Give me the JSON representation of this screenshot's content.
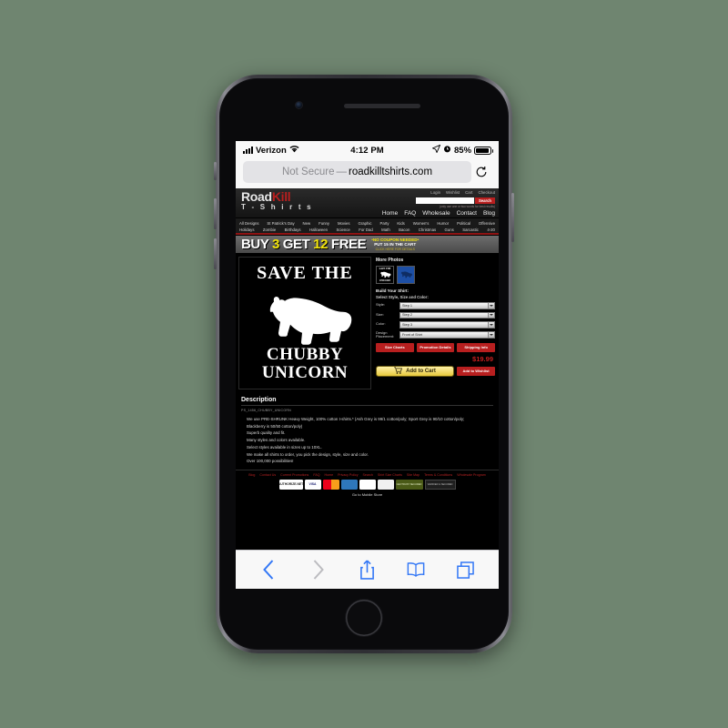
{
  "device": {
    "statusbar": {
      "carrier": "Verizon",
      "time": "4:12 PM",
      "battery_percent": "85%",
      "signal_icon": "signal-bars-icon",
      "wifi_icon": "wifi-icon",
      "location_icon": "location-arrow-icon",
      "alarm_icon": "alarm-clock-icon",
      "battery_icon": "battery-icon"
    },
    "browser": {
      "security_label": "Not Secure",
      "separator": "—",
      "host": "roadkilltshirts.com",
      "reload_icon": "reload-icon",
      "toolbar": {
        "back_icon": "chevron-left-icon",
        "forward_icon": "chevron-right-icon",
        "share_icon": "share-icon",
        "bookmarks_icon": "book-icon",
        "tabs_icon": "tabs-icon"
      }
    },
    "home_button": "home-button"
  },
  "site": {
    "logo": {
      "part1": "Road",
      "part2": "Kill",
      "line2": "T - S h i r t s"
    },
    "top_links": [
      "Login",
      "Wishlist",
      "Cart",
      "Checkout"
    ],
    "search": {
      "placeholder": "",
      "value": "",
      "button": "Search",
      "note": "(only use one or two words for best results)"
    },
    "main_nav": [
      "Home",
      "FAQ",
      "Wholesale",
      "Contact",
      "Blog"
    ],
    "cat_row1": [
      "All Designs",
      "St Patrick's Day",
      "New",
      "Funny",
      "Movies",
      "Graphic",
      "Party",
      "Kids",
      "Women's",
      "Humor",
      "Political",
      "Offensive"
    ],
    "cat_row2": [
      "Holidays",
      "Zombie",
      "Birthdays",
      "Halloween",
      "Science",
      "For Dad",
      "Math",
      "Bacon",
      "Christmas",
      "Guns",
      "Sarcastic",
      "4-20"
    ],
    "promo": {
      "buy": "BUY",
      "three": "3",
      "get": "GET",
      "twelve": "12",
      "free": "FREE",
      "line1": "•NO COUPON NEEDED•",
      "line2": "PUT 15 IN THE CART",
      "line3": "CLICK HERE FOR DETAILS"
    }
  },
  "product": {
    "design": {
      "top_text": "SAVE THE",
      "bottom_text1": "CHUBBY",
      "bottom_text2": "UNICORN",
      "graphic": "rhino-silhouette"
    },
    "more_photos_label": "More Photos",
    "thumbnails": [
      {
        "name": "thumbnail-design-black",
        "color": "#000000"
      },
      {
        "name": "thumbnail-shirt-blue",
        "color": "#1d4fa5"
      }
    ],
    "build_label": "Build Your Shirt:",
    "select_label": "Select Style, Size and Color:",
    "options": [
      {
        "label": "Style:",
        "value": "Step 1"
      },
      {
        "label": "Size:",
        "value": "Step 2"
      },
      {
        "label": "Color:",
        "value": "Step 3"
      },
      {
        "label": "Design Placement:",
        "value": "Front of Shirt"
      }
    ],
    "pills": [
      "Size Charts",
      "Promotion Details",
      "Shipping Info"
    ],
    "price": "$19.99",
    "add_to_cart": "Add to Cart",
    "cart_icon": "shopping-cart-icon",
    "add_to_wishlist": "Add to Wishlist"
  },
  "description": {
    "heading": "Description",
    "sku": "PS_1456_CHUBBY_UNICORN",
    "lines": [
      "We use PRE-SHRUNK Heavy Weight, 100% cotton t-shirts.* (Ash Grey is 99/1 cotton/poly; Sport Grey is 90/10 cotton/poly;",
      "Blackberry is 50/50 cotton/poly)",
      "Superb quality and fit.",
      "Many styles and colors available.",
      "Select styles available in sizes up to 10XL.",
      "We make all shirts to order, you pick the design, style, size and color.",
      "Over 100,000 possibilities!"
    ]
  },
  "footer": {
    "links": [
      "Blog",
      "Contact Us",
      "Current Promotions",
      "FAQ",
      "Home",
      "Privacy Policy",
      "Search",
      "Shirt Size Charts",
      "Site Map",
      "Terms & Conditions",
      "Wholesale Program"
    ],
    "payments": [
      "AUTHORIZE.NET",
      "VISA",
      "MasterCard",
      "AMEX",
      "PayPal",
      "DISCOVER"
    ],
    "seals": [
      "GEOTRUST SECURED",
      "VERIFIED & SECURED"
    ],
    "mobile_link": "Go to Mobile Store"
  },
  "colors": {
    "brand_red": "#b81f1f",
    "promo_yellow": "#f2e40b",
    "safari_blue": "#3478f6",
    "price_red": "#c81f1f"
  }
}
